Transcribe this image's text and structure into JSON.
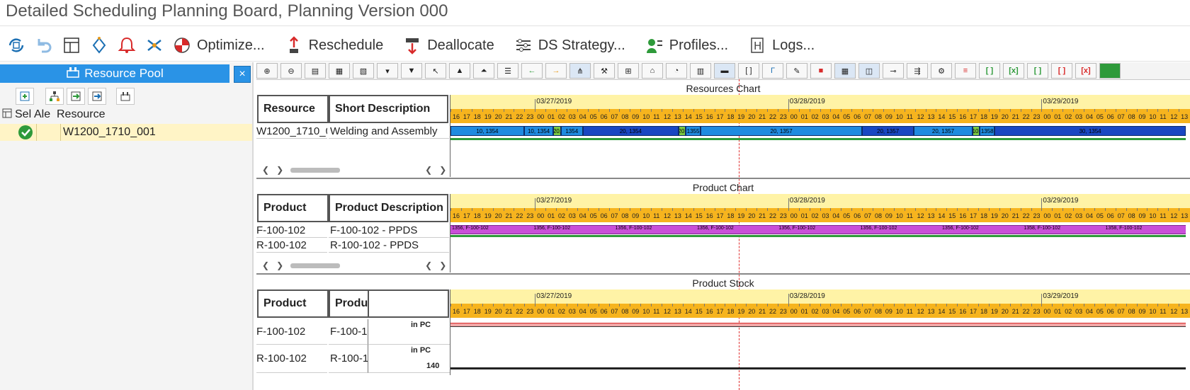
{
  "window": {
    "title": "Detailed Scheduling Planning Board, Planning Version 000"
  },
  "toolbar": {
    "optimize_label": "Optimize...",
    "reschedule_label": "Reschedule",
    "deallocate_label": "Deallocate",
    "ds_strategy_label": "DS Strategy...",
    "profiles_label": "Profiles...",
    "logs_label": "Logs..."
  },
  "resource_pool": {
    "title": "Resource Pool",
    "close": "×",
    "columns": {
      "sel": "Sel",
      "ale": "Ale",
      "resource": "Resource"
    },
    "rows": [
      {
        "resource": "W1200_1710_001"
      }
    ]
  },
  "resources_chart": {
    "title": "Resources Chart",
    "col_resource": "Resource",
    "col_short_desc": "Short Description",
    "rows": [
      {
        "resource": "W1200_1710_0",
        "desc": "Welding and Assembly"
      }
    ],
    "bars": [
      {
        "label": "10, 1354",
        "color": "#1f8be0",
        "start": 0.0,
        "end": 0.1
      },
      {
        "label": "10, 1354",
        "color": "#1f8be0",
        "start": 0.1,
        "end": 0.14
      },
      {
        "label": "20,",
        "color": "#7ac943",
        "start": 0.14,
        "end": 0.15
      },
      {
        "label": "1354",
        "color": "#1f8be0",
        "start": 0.15,
        "end": 0.18
      },
      {
        "label": "20, 1354",
        "color": "#1947c2",
        "start": 0.18,
        "end": 0.31
      },
      {
        "label": "20,",
        "color": "#7ac943",
        "start": 0.31,
        "end": 0.32
      },
      {
        "label": "1355",
        "color": "#1f8be0",
        "start": 0.32,
        "end": 0.34
      },
      {
        "label": "20, 1357",
        "color": "#1f8be0",
        "start": 0.34,
        "end": 0.56
      },
      {
        "label": "20, 1357",
        "color": "#1947c2",
        "start": 0.56,
        "end": 0.63
      },
      {
        "label": "20, 1357",
        "color": "#1f8be0",
        "start": 0.63,
        "end": 0.71
      },
      {
        "label": "10,",
        "color": "#7ac943",
        "start": 0.71,
        "end": 0.72
      },
      {
        "label": "1358",
        "color": "#1f8be0",
        "start": 0.72,
        "end": 0.74
      },
      {
        "label": "30, 1354",
        "color": "#1947c2",
        "start": 0.74,
        "end": 1.0
      }
    ]
  },
  "product_chart": {
    "title": "Product Chart",
    "col_product": "Product",
    "col_product_desc": "Product Description",
    "rows": [
      {
        "product": "F-100-102",
        "desc": "F-100-102 - PPDS"
      },
      {
        "product": "R-100-102",
        "desc": "R-100-102 - PPDS"
      }
    ],
    "bar_labels": [
      "1356, F-100-102",
      "1356, F-100-102",
      "1356, F-100-102",
      "1356, F-100-102",
      "1356, F-100-102",
      "1356, F-100-102",
      "1356, F-100-102",
      "1358, F-100-102",
      "1358, F-100-102"
    ]
  },
  "product_stock": {
    "title": "Product Stock",
    "col_product": "Product",
    "col_product_desc": "Produ",
    "rows": [
      {
        "product": "F-100-102",
        "desc": "F-100-10",
        "unit": "in  PC",
        "value": ""
      },
      {
        "product": "R-100-102",
        "desc": "R-100-10",
        "unit": "in  PC",
        "value": "140"
      }
    ]
  },
  "timeline": {
    "dates": [
      "03/27/2019",
      "03/28/2019",
      "03/29/2019"
    ],
    "hours": [
      "16",
      "17",
      "18",
      "19",
      "20",
      "21",
      "22",
      "23",
      "00",
      "01",
      "02",
      "03",
      "04",
      "05",
      "06",
      "07",
      "08",
      "09",
      "10",
      "11",
      "12",
      "13",
      "14",
      "15",
      "16",
      "17",
      "18",
      "19",
      "20",
      "21",
      "22",
      "23",
      "00",
      "01",
      "02",
      "03",
      "04",
      "05",
      "06",
      "07",
      "08",
      "09",
      "10",
      "11",
      "12",
      "13",
      "14",
      "15",
      "16",
      "17",
      "18",
      "19",
      "20",
      "21",
      "22",
      "23",
      "00",
      "01",
      "02",
      "03",
      "04",
      "05",
      "06",
      "07",
      "08",
      "09",
      "10",
      "11",
      "12",
      "13"
    ]
  },
  "colors": {
    "accent": "#2a93e6",
    "date_bar": "#fff3a6",
    "hour_bar": "#f6b41e",
    "row_highlight": "#fff4c6",
    "product_bar": "#c94fd8"
  }
}
